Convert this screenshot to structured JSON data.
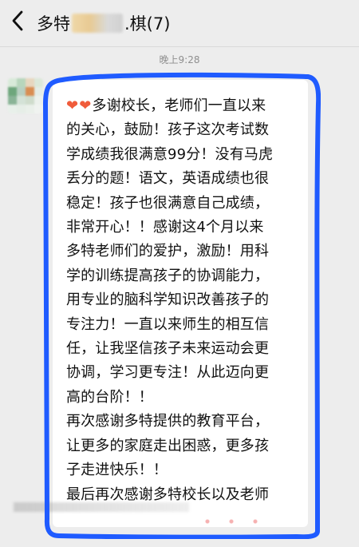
{
  "header": {
    "title_prefix": "多特",
    "title_suffix": "‪.棋(7)"
  },
  "chat": {
    "timestamp": "晚上9:28",
    "message": {
      "hearts": [
        "❤",
        "❤"
      ],
      "lines": [
        "多谢校长，老师们一直以来",
        "的关心，鼓励！孩子这次考试数",
        "学成绩我很满意99分！没有马虎",
        "丢分的题！语文，英语成绩也很",
        "稳定！孩子也很满意自己成绩，",
        "非常开心！！感谢这4个月以来",
        "多特老师们的爱护，激励！用科",
        "学的训练提高孩子的协调能力，",
        "用专业的脑科学知识改善孩子的",
        "专注力！一直以来师生的相互信",
        "任，让我坚信孩子未来运动会更",
        "协调，学习更专注！从此迈向更",
        "高的台阶！！",
        "再次感谢多特提供的教育平台，",
        "让更多的家庭走出困惑，更多孩",
        "子走进快乐！！",
        "最后再次感谢多特校长以及老师"
      ]
    }
  },
  "colors": {
    "background": "#ededed",
    "bubble": "#ffffff",
    "annotation": "#1f5bff",
    "heart": "#f05c3b"
  },
  "icons": {
    "back": "chevron-left-icon"
  }
}
